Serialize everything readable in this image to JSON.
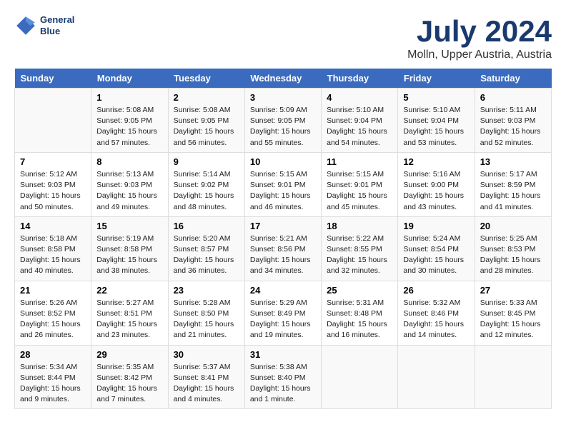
{
  "header": {
    "logo_line1": "General",
    "logo_line2": "Blue",
    "title": "July 2024",
    "subtitle": "Molln, Upper Austria, Austria"
  },
  "calendar": {
    "days_of_week": [
      "Sunday",
      "Monday",
      "Tuesday",
      "Wednesday",
      "Thursday",
      "Friday",
      "Saturday"
    ],
    "weeks": [
      [
        {
          "day": "",
          "info": ""
        },
        {
          "day": "1",
          "info": "Sunrise: 5:08 AM\nSunset: 9:05 PM\nDaylight: 15 hours\nand 57 minutes."
        },
        {
          "day": "2",
          "info": "Sunrise: 5:08 AM\nSunset: 9:05 PM\nDaylight: 15 hours\nand 56 minutes."
        },
        {
          "day": "3",
          "info": "Sunrise: 5:09 AM\nSunset: 9:05 PM\nDaylight: 15 hours\nand 55 minutes."
        },
        {
          "day": "4",
          "info": "Sunrise: 5:10 AM\nSunset: 9:04 PM\nDaylight: 15 hours\nand 54 minutes."
        },
        {
          "day": "5",
          "info": "Sunrise: 5:10 AM\nSunset: 9:04 PM\nDaylight: 15 hours\nand 53 minutes."
        },
        {
          "day": "6",
          "info": "Sunrise: 5:11 AM\nSunset: 9:03 PM\nDaylight: 15 hours\nand 52 minutes."
        }
      ],
      [
        {
          "day": "7",
          "info": "Sunrise: 5:12 AM\nSunset: 9:03 PM\nDaylight: 15 hours\nand 50 minutes."
        },
        {
          "day": "8",
          "info": "Sunrise: 5:13 AM\nSunset: 9:03 PM\nDaylight: 15 hours\nand 49 minutes."
        },
        {
          "day": "9",
          "info": "Sunrise: 5:14 AM\nSunset: 9:02 PM\nDaylight: 15 hours\nand 48 minutes."
        },
        {
          "day": "10",
          "info": "Sunrise: 5:15 AM\nSunset: 9:01 PM\nDaylight: 15 hours\nand 46 minutes."
        },
        {
          "day": "11",
          "info": "Sunrise: 5:15 AM\nSunset: 9:01 PM\nDaylight: 15 hours\nand 45 minutes."
        },
        {
          "day": "12",
          "info": "Sunrise: 5:16 AM\nSunset: 9:00 PM\nDaylight: 15 hours\nand 43 minutes."
        },
        {
          "day": "13",
          "info": "Sunrise: 5:17 AM\nSunset: 8:59 PM\nDaylight: 15 hours\nand 41 minutes."
        }
      ],
      [
        {
          "day": "14",
          "info": "Sunrise: 5:18 AM\nSunset: 8:58 PM\nDaylight: 15 hours\nand 40 minutes."
        },
        {
          "day": "15",
          "info": "Sunrise: 5:19 AM\nSunset: 8:58 PM\nDaylight: 15 hours\nand 38 minutes."
        },
        {
          "day": "16",
          "info": "Sunrise: 5:20 AM\nSunset: 8:57 PM\nDaylight: 15 hours\nand 36 minutes."
        },
        {
          "day": "17",
          "info": "Sunrise: 5:21 AM\nSunset: 8:56 PM\nDaylight: 15 hours\nand 34 minutes."
        },
        {
          "day": "18",
          "info": "Sunrise: 5:22 AM\nSunset: 8:55 PM\nDaylight: 15 hours\nand 32 minutes."
        },
        {
          "day": "19",
          "info": "Sunrise: 5:24 AM\nSunset: 8:54 PM\nDaylight: 15 hours\nand 30 minutes."
        },
        {
          "day": "20",
          "info": "Sunrise: 5:25 AM\nSunset: 8:53 PM\nDaylight: 15 hours\nand 28 minutes."
        }
      ],
      [
        {
          "day": "21",
          "info": "Sunrise: 5:26 AM\nSunset: 8:52 PM\nDaylight: 15 hours\nand 26 minutes."
        },
        {
          "day": "22",
          "info": "Sunrise: 5:27 AM\nSunset: 8:51 PM\nDaylight: 15 hours\nand 23 minutes."
        },
        {
          "day": "23",
          "info": "Sunrise: 5:28 AM\nSunset: 8:50 PM\nDaylight: 15 hours\nand 21 minutes."
        },
        {
          "day": "24",
          "info": "Sunrise: 5:29 AM\nSunset: 8:49 PM\nDaylight: 15 hours\nand 19 minutes."
        },
        {
          "day": "25",
          "info": "Sunrise: 5:31 AM\nSunset: 8:48 PM\nDaylight: 15 hours\nand 16 minutes."
        },
        {
          "day": "26",
          "info": "Sunrise: 5:32 AM\nSunset: 8:46 PM\nDaylight: 15 hours\nand 14 minutes."
        },
        {
          "day": "27",
          "info": "Sunrise: 5:33 AM\nSunset: 8:45 PM\nDaylight: 15 hours\nand 12 minutes."
        }
      ],
      [
        {
          "day": "28",
          "info": "Sunrise: 5:34 AM\nSunset: 8:44 PM\nDaylight: 15 hours\nand 9 minutes."
        },
        {
          "day": "29",
          "info": "Sunrise: 5:35 AM\nSunset: 8:42 PM\nDaylight: 15 hours\nand 7 minutes."
        },
        {
          "day": "30",
          "info": "Sunrise: 5:37 AM\nSunset: 8:41 PM\nDaylight: 15 hours\nand 4 minutes."
        },
        {
          "day": "31",
          "info": "Sunrise: 5:38 AM\nSunset: 8:40 PM\nDaylight: 15 hours\nand 1 minute."
        },
        {
          "day": "",
          "info": ""
        },
        {
          "day": "",
          "info": ""
        },
        {
          "day": "",
          "info": ""
        }
      ]
    ]
  }
}
